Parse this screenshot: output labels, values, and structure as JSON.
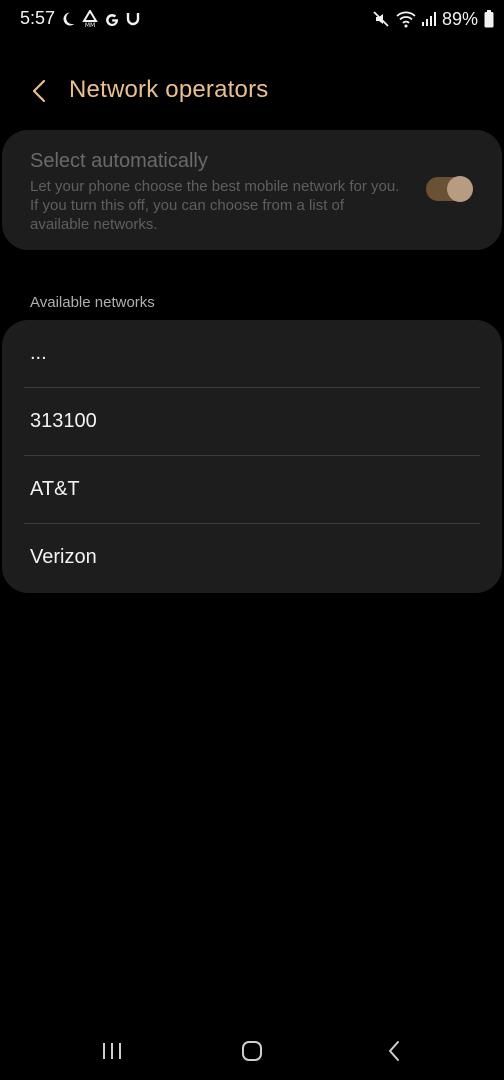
{
  "status_bar": {
    "time": "5:57",
    "left_icons": [
      "moon-icon",
      "mm-icon",
      "google-icon",
      "magnet-icon"
    ],
    "right_icons": [
      "mute-icon",
      "wifi-icon",
      "signal-icon"
    ],
    "battery_text": "89%",
    "battery_icon": "battery-icon"
  },
  "header": {
    "title": "Network operators",
    "back_icon": "chevron-left-icon",
    "accent_color": "#e9bf91"
  },
  "auto_select": {
    "title": "Select automatically",
    "description": "Let your phone choose the best mobile network for you. If you turn this off, you can choose from a list of available networks.",
    "toggle_on": true
  },
  "available_networks": {
    "label": "Available networks",
    "items": [
      {
        "label": "..."
      },
      {
        "label": "313100"
      },
      {
        "label": "AT&T"
      },
      {
        "label": "Verizon"
      }
    ]
  },
  "nav_bar": {
    "recent_icon": "recent-apps-icon",
    "home_icon": "home-icon",
    "back_icon": "back-icon"
  }
}
